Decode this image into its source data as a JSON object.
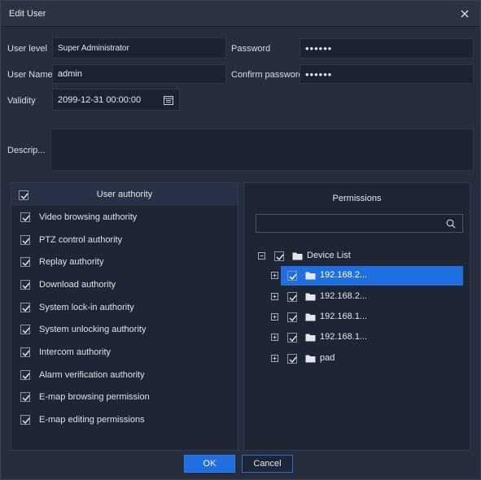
{
  "window": {
    "title": "Edit User"
  },
  "form": {
    "user_level_label": "User level",
    "user_level_value": "Super Administrator",
    "password_label": "Password",
    "password_value": "••••••",
    "user_name_label": "User Name",
    "user_name_value": "admin",
    "confirm_password_label": "Confirm password",
    "confirm_password_value": "••••••",
    "validity_label": "Validity",
    "validity_value": "2099-12-31 00:00:00",
    "description_label": "Descrip...",
    "description_value": ""
  },
  "authority": {
    "header": "User authority",
    "items": [
      {
        "label": "Video browsing authority",
        "checked": true
      },
      {
        "label": "PTZ control authority",
        "checked": true
      },
      {
        "label": "Replay authority",
        "checked": true
      },
      {
        "label": "Download authority",
        "checked": true
      },
      {
        "label": "System lock-in authority",
        "checked": true
      },
      {
        "label": "System unlocking authority",
        "checked": true
      },
      {
        "label": "Intercom authority",
        "checked": true
      },
      {
        "label": "Alarm verification authority",
        "checked": true
      },
      {
        "label": "E-map browsing permission",
        "checked": true
      },
      {
        "label": "E-map editing permissions",
        "checked": true
      }
    ]
  },
  "permissions": {
    "header": "Permissions",
    "search_value": "",
    "tree": {
      "root": "Device List",
      "children": [
        {
          "label": "192.168.2...",
          "selected": true
        },
        {
          "label": "192.168.2...",
          "selected": false
        },
        {
          "label": "192.168.1...",
          "selected": false
        },
        {
          "label": "192.168.1...",
          "selected": false
        },
        {
          "label": "pad",
          "selected": false
        }
      ]
    }
  },
  "buttons": {
    "ok": "OK",
    "cancel": "Cancel"
  },
  "colors": {
    "accent": "#1f6fe0",
    "background": "#262e3d",
    "field": "#1b2232"
  }
}
